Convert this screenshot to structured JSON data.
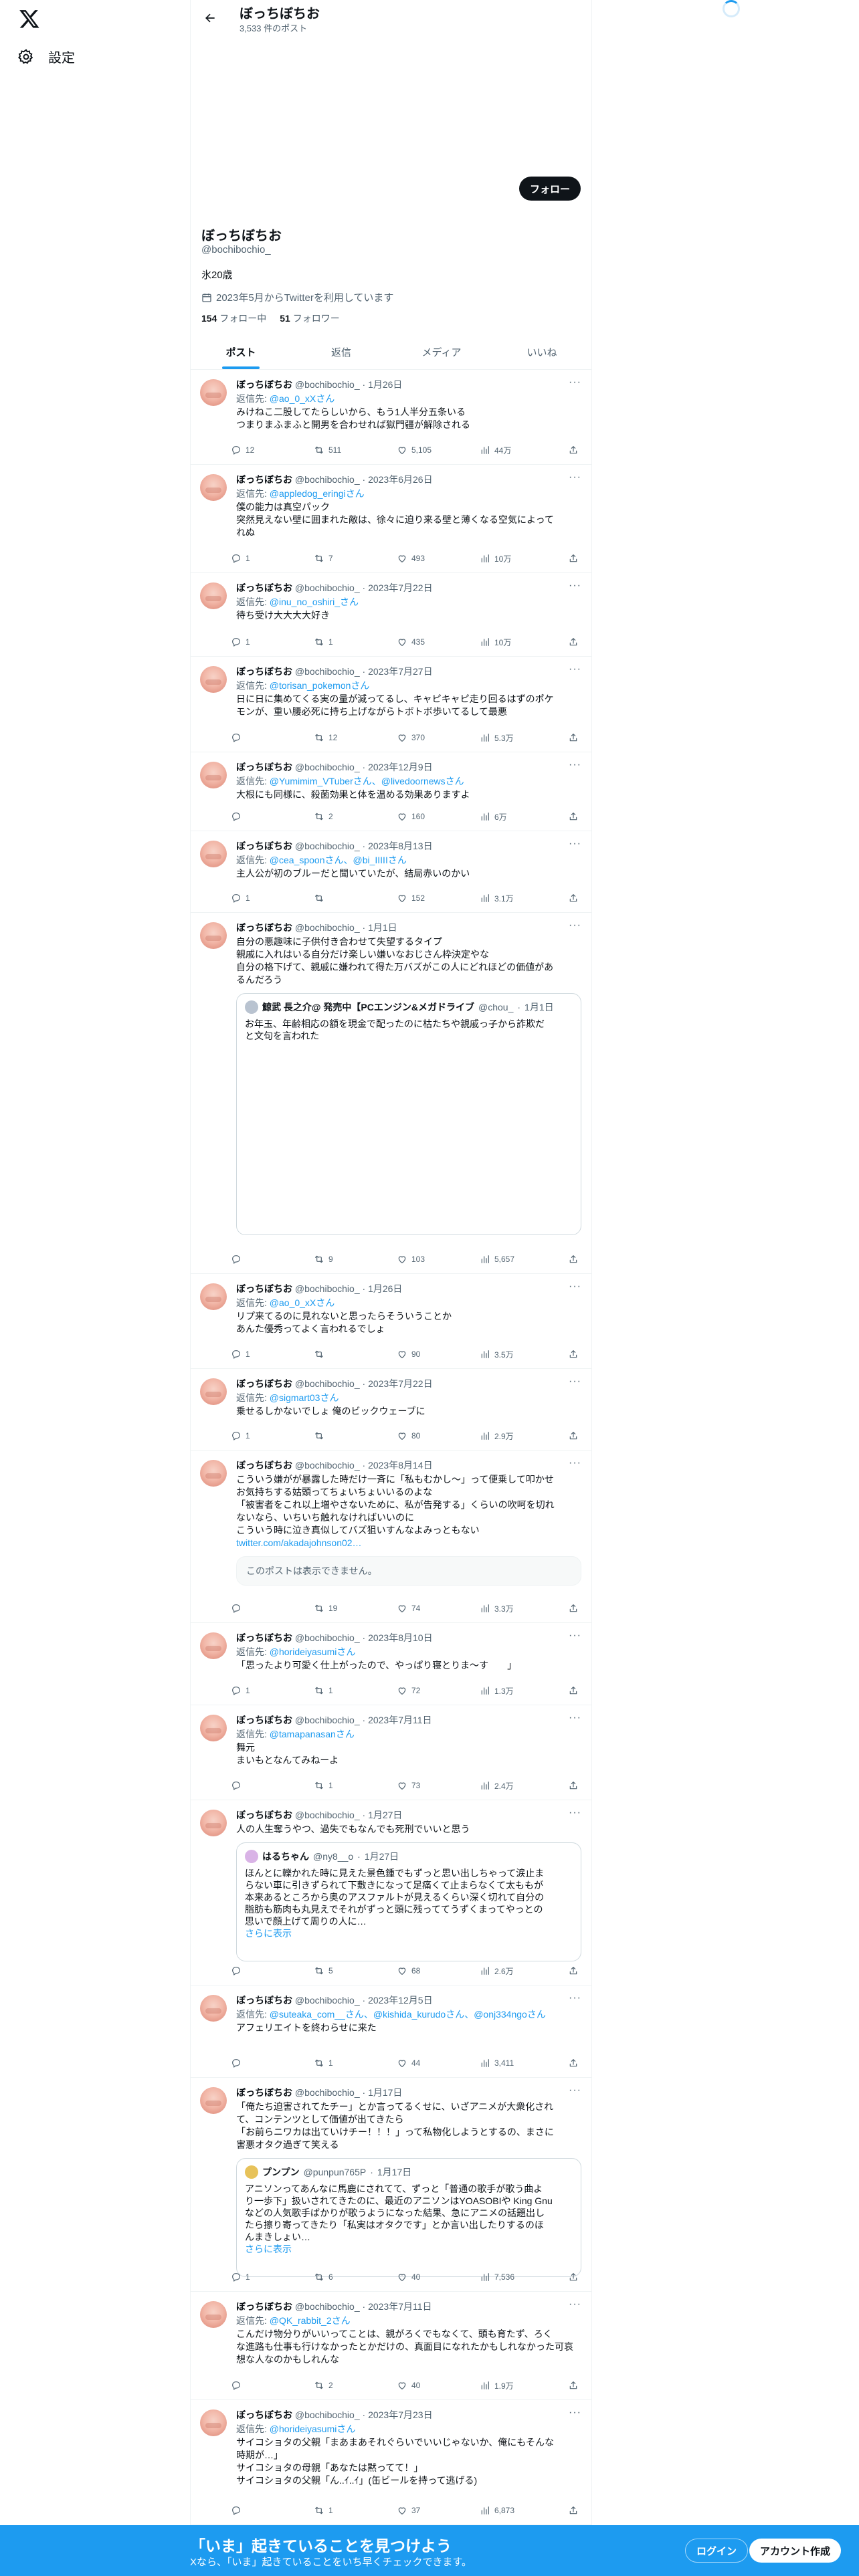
{
  "nav": {
    "settings_label": "設定"
  },
  "topbar": {
    "title": "ぼっちぼちお",
    "post_count": "3,533 件のポスト"
  },
  "profile": {
    "follow_button": "フォロー",
    "name": "ぼっちぼちお",
    "handle": "@bochibochio_",
    "bio": "氷20歳",
    "joined": "2023年5月からTwitterを利用しています",
    "following_count": "154",
    "following_label": "フォロー中",
    "followers_count": "51",
    "followers_label": "フォロワー"
  },
  "tabs": [
    "ポスト",
    "返信",
    "メディア",
    "いいね"
  ],
  "tweets": [
    {
      "name": "ぼっちぼちお",
      "handle": "@bochibochio_",
      "date": "1月26日",
      "reply_prefix": "返信先: ",
      "reply_to": "@ao_0_xXさん",
      "lines": [
        "みけねこ二股してたらしいから、もう1人半分五条いる",
        "つまりまふまふと開男を合わせれば獄門疆が解除される"
      ],
      "replies": "12",
      "reposts": "511",
      "likes": "5,105",
      "views": "44万"
    },
    {
      "name": "ぼっちぼちお",
      "handle": "@bochibochio_",
      "date": "2023年6月26日",
      "reply_prefix": "返信先: ",
      "reply_to": "@appledog_eringiさん",
      "lines": [
        "僕の能力は真空パック",
        "突然見えない壁に囲まれた敵は、徐々に迫り来る壁と薄くなる空気によって",
        "れぬ"
      ],
      "replies": "1",
      "reposts": "7",
      "likes": "493",
      "views": "10万"
    },
    {
      "name": "ぼっちぼちお",
      "handle": "@bochibochio_",
      "date": "2023年7月22日",
      "reply_prefix": "返信先: ",
      "reply_to": "@inu_no_oshiri_さん",
      "lines": [
        "待ち受け大大大大好き"
      ],
      "replies": "1",
      "reposts": "1",
      "likes": "435",
      "views": "10万"
    },
    {
      "name": "ぼっちぼちお",
      "handle": "@bochibochio_",
      "date": "2023年7月27日",
      "reply_prefix": "返信先: ",
      "reply_to": "@torisan_pokemonさん",
      "lines": [
        "日に日に集めてくる実の量が減ってるし、キャピキャピ走り回るはずのポケ",
        "モンが、重い腰必死に持ち上げながらトボトボ歩いてるして最悪"
      ],
      "replies": "",
      "reposts": "12",
      "likes": "370",
      "views": "5.3万"
    },
    {
      "name": "ぼっちぼちお",
      "handle": "@bochibochio_",
      "date": "2023年12月9日",
      "reply_prefix": "返信先: ",
      "reply_to": "@Yumimim_VTuberさん、@livedoornewsさん",
      "lines": [
        "大根にも同様に、殺菌効果と体を温める効果ありますよ"
      ],
      "replies": "",
      "reposts": "2",
      "likes": "160",
      "views": "6万"
    },
    {
      "name": "ぼっちぼちお",
      "handle": "@bochibochio_",
      "date": "2023年8月13日",
      "reply_prefix": "返信先: ",
      "reply_to": "@cea_spoonさん、@bi_IIIIIさん",
      "lines": [
        "主人公が初のブルーだと聞いていたが、結局赤いのかい"
      ],
      "replies": "1",
      "reposts": "",
      "likes": "152",
      "views": "3.1万"
    },
    {
      "name": "ぼっちぼちお",
      "handle": "@bochibochio_",
      "date": "1月1日",
      "reply_prefix": "",
      "reply_to": "",
      "lines": [
        "自分の悪趣味に子供付き合わせて失望するタイプ",
        "親戚に入れはいる自分だけ楽しい嫌いなおじさん枠決定やな",
        "自分の格下げて、親戚に嫌われて得た万バズがこの人にどれほどの価値があ",
        "るんだろう"
      ],
      "quote": {
        "name": "鯨武 長之介@ 発売中【PCエンジン&メガドライブ",
        "handle": "@chou_",
        "date": "1月1日",
        "lines": [
          "お年玉、年齢相応の額を現金で配ったのに枯たちや親戚っ子から詐欺だ",
          "と文句を言われた"
        ]
      },
      "replies": "",
      "reposts": "9",
      "likes": "103",
      "views": "5,657"
    },
    {
      "name": "ぼっちぼちお",
      "handle": "@bochibochio_",
      "date": "1月26日",
      "reply_prefix": "返信先: ",
      "reply_to": "@ao_0_xXさん",
      "lines": [
        "リプ来てるのに見れないと思ったらそういうことか",
        "あんた優秀ってよく言われるでしょ"
      ],
      "replies": "1",
      "reposts": "",
      "likes": "90",
      "views": "3.5万"
    },
    {
      "name": "ぼっちぼちお",
      "handle": "@bochibochio_",
      "date": "2023年7月22日",
      "reply_prefix": "返信先: ",
      "reply_to": "@sigmart03さん",
      "lines": [
        "乗せるしかないでしょ 俺のビックウェーブに"
      ],
      "replies": "1",
      "reposts": "",
      "likes": "80",
      "views": "2.9万"
    },
    {
      "name": "ぼっちぼちお",
      "handle": "@bochibochio_",
      "date": "2023年8月14日",
      "reply_prefix": "",
      "reply_to": "",
      "lines": [
        "こういう嫌がが暴露した時だけ一斉に「私もむかし〜」って便乗して叩かせ",
        "お気持ちする姑頭ってちょいちょいいるのよな",
        "「被害者をこれ以上増やさないために、私が告発する」くらいの吹呵を切れ",
        "ないなら、いちいち触れなければいいのに",
        "こういう時に泣き真似してバズ狙いすんなよみっともない"
      ],
      "link": "twitter.com/akadajohnson02…",
      "unavailable": "このポストは表示できません。",
      "replies": "",
      "reposts": "19",
      "likes": "74",
      "views": "3.3万"
    },
    {
      "name": "ぼっちぼちお",
      "handle": "@bochibochio_",
      "date": "2023年8月10日",
      "reply_prefix": "返信先: ",
      "reply_to": "@horideiyasumiさん",
      "lines": [
        "「思ったより可愛く仕上がったので、やっぱり寝とりま〜す　　」"
      ],
      "replies": "1",
      "reposts": "1",
      "likes": "72",
      "views": "1.3万"
    },
    {
      "name": "ぼっちぼちお",
      "handle": "@bochibochio_",
      "date": "2023年7月11日",
      "reply_prefix": "返信先: ",
      "reply_to": "@tamapanasanさん",
      "lines": [
        "舞元",
        "まいもとなんてみねーよ"
      ],
      "replies": "",
      "reposts": "1",
      "likes": "73",
      "views": "2.4万"
    },
    {
      "name": "ぼっちぼちお",
      "handle": "@bochibochio_",
      "date": "1月27日",
      "reply_prefix": "",
      "reply_to": "",
      "lines": [
        "人の人生奪うやつ、過失でもなんでも死刑でいいと思う"
      ],
      "quote": {
        "name": "はるちゃん",
        "handle": "@ny8__o",
        "date": "1月27日",
        "lines": [
          "ほんとに轢かれた時に見えた景色鍾でもずっと思い出しちゃって涙止ま",
          "らない車に引きずられて下敷きになって足痛くて止まらなくて太ももが",
          "本来あるところから奥のアスファルトが見えるくらい深く切れて自分の",
          "脂肪も筋肉も丸見えでそれがずっと頭に残っててうずくまってやっとの",
          "思いで顔上げて周りの人に…"
        ],
        "more": "さらに表示"
      },
      "replies": "",
      "reposts": "5",
      "likes": "68",
      "views": "2.6万"
    },
    {
      "name": "ぼっちぼちお",
      "handle": "@bochibochio_",
      "date": "2023年12月5日",
      "reply_prefix": "返信先: ",
      "reply_to": "@suteaka_com__さん、@kishida_kurudoさん、@onj334ngoさん",
      "lines": [
        "アフェリエイトを終わらせに来た"
      ],
      "replies": "",
      "reposts": "1",
      "likes": "44",
      "views": "3,411"
    },
    {
      "name": "ぼっちぼちお",
      "handle": "@bochibochio_",
      "date": "1月17日",
      "reply_prefix": "",
      "reply_to": "",
      "lines": [
        "「俺たち迫害されてたチー」とか言ってるくせに、いざアニメが大衆化され",
        "て、コンテンツとして価値が出てきたら",
        "「お前らニワカは出ていけチー！！！」って私物化しようとするの、まさに",
        "害悪オタク過ぎて笑える"
      ],
      "quote": {
        "name": "プンプン",
        "handle": "@punpun765P",
        "date": "1月17日",
        "lines": [
          "アニソンってあんなに馬鹿にされてて、ずっと「普通の歌手が歌う曲よ",
          "り一歩下」扱いされてきたのに、最近のアニソンはYOASOBIや King Gnu",
          "などの人気歌手ばかりが歌うようになった結果、急にアニメの話題出し",
          "たら擦り寄ってきたり「私実はオタクです」とか言い出したりするのほ",
          "んまきしょい…"
        ],
        "more": "さらに表示"
      },
      "replies": "1",
      "reposts": "6",
      "likes": "40",
      "views": "7,536"
    },
    {
      "name": "ぼっちぼちお",
      "handle": "@bochibochio_",
      "date": "2023年7月11日",
      "reply_prefix": "返信先: ",
      "reply_to": "@QK_rabbit_2さん",
      "lines": [
        "こんだけ物分りがいいってことは、親がろくでもなくて、頭も育たず、ろく",
        "な進路も仕事も行けなかったとかだけの、真面目になれたかもしれなかった可哀",
        "想な人なのかもしれんな"
      ],
      "replies": "",
      "reposts": "2",
      "likes": "40",
      "views": "1.9万"
    },
    {
      "name": "ぼっちぼちお",
      "handle": "@bochibochio_",
      "date": "2023年7月23日",
      "reply_prefix": "返信先: ",
      "reply_to": "@horideiyasumiさん",
      "lines": [
        "サイコショタの父親「まあまあそれぐらいでいいじゃないか、俺にもそんな",
        "時期が…」",
        "サイコショタの母親「あなたは黙ってて！」",
        "サイコショタの父親「ん..ｲ..ｲ」(缶ビールを持って逃げる)"
      ],
      "replies": "",
      "reposts": "1",
      "likes": "37",
      "views": "6,873"
    }
  ],
  "bottom": {
    "title": "「いま」起きていることを見つけよう",
    "subtitle": "Xなら、「いま」起きていることをいち早くチェックできます。",
    "login": "ログイン",
    "signup": "アカウント作成"
  }
}
